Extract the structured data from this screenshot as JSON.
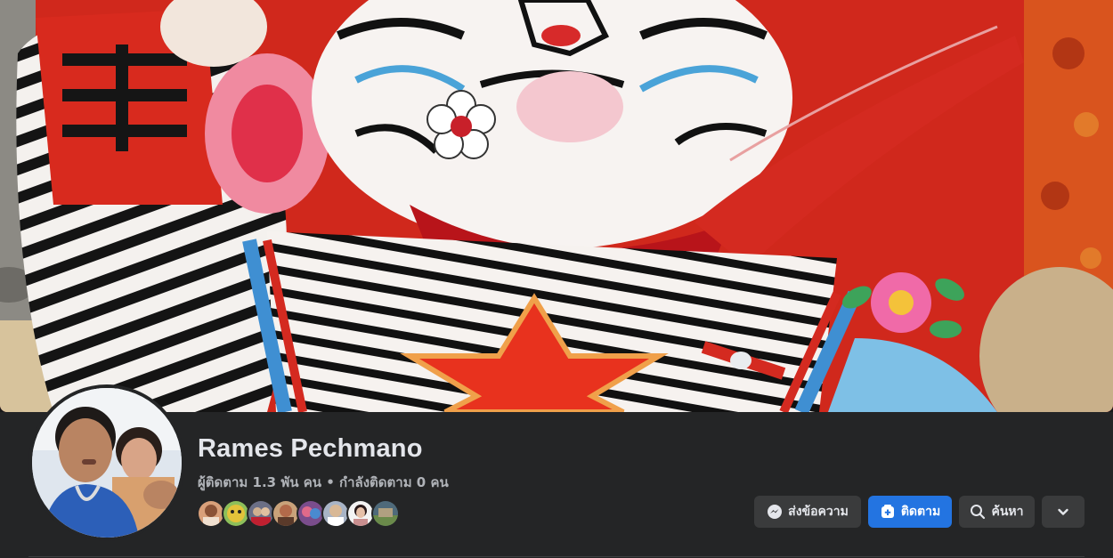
{
  "profile": {
    "name": "Rames Pechmano",
    "stats": "ผู้ติดตาม 1.3 พัน คน • กำลังติดตาม 0 คน"
  },
  "friends": {
    "avatar_colors": [
      "#d9a07a",
      "#e3c23a",
      "#6b6f86",
      "#b26a4a",
      "#7a4d8c",
      "#a8b4c6",
      "#c98f8f",
      "#4f6a7a"
    ]
  },
  "actions": {
    "message_label": "ส่งข้อความ",
    "follow_label": "ติดตาม",
    "search_label": "ค้นหา"
  },
  "colors": {
    "accent": "#2374e1",
    "background": "#18191a",
    "panel": "#242526",
    "button": "#3a3b3c"
  }
}
